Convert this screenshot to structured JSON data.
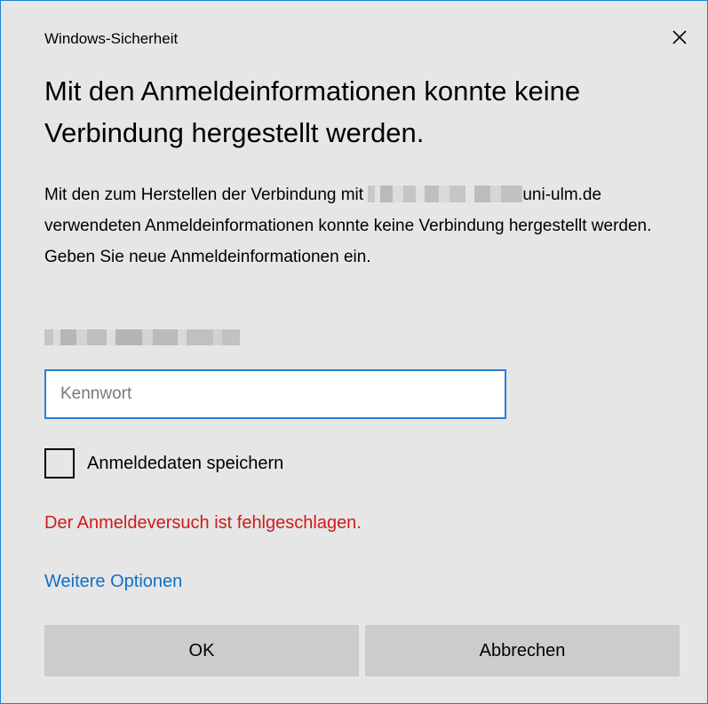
{
  "window": {
    "title": "Windows-Sicherheit",
    "close_label": "✕"
  },
  "dialog": {
    "heading": "Mit den Anmeldeinformationen konnte keine Verbindung hergestellt werden.",
    "message_before": "Mit den zum Herstellen der Verbindung mit ",
    "message_after": "uni-ulm.de verwendeten Anmeldeinformationen konnte keine Verbindung hergestellt werden. Geben Sie neue Anmeldeinformationen ein."
  },
  "form": {
    "password_placeholder": "Kennwort",
    "password_value": "",
    "remember_label": "Anmeldedaten speichern",
    "remember_checked": false
  },
  "status": {
    "error_text": "Der Anmeldeversuch ist fehlgeschlagen.",
    "error_color": "#d11a1a"
  },
  "links": {
    "more_options": "Weitere Optionen"
  },
  "buttons": {
    "ok": "OK",
    "cancel": "Abbrechen"
  },
  "colors": {
    "accent": "#1883d7",
    "background": "#e6e6e6",
    "button": "#cccccc",
    "link": "#0f6fc6"
  }
}
